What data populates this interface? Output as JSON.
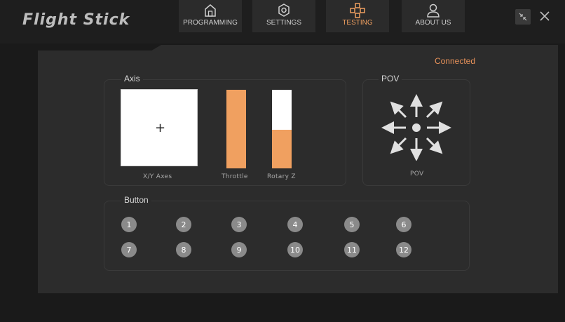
{
  "app": {
    "title": "Flight Stick"
  },
  "tabs": [
    {
      "label": "PROGRAMMING",
      "icon": "home-icon"
    },
    {
      "label": "SETTINGS",
      "icon": "gear-icon"
    },
    {
      "label": "TESTING",
      "icon": "gamepad-icon",
      "active": true
    },
    {
      "label": "ABOUT US",
      "icon": "user-icon"
    }
  ],
  "status": {
    "text": "Connected",
    "color": "#e8925a"
  },
  "axis": {
    "title": "Axis",
    "xy_label": "X/Y Axes",
    "throttle_label": "Throttle",
    "throttle_level": 1.0,
    "rotary_label": "Rotary Z",
    "rotary_level": 0.49
  },
  "pov": {
    "title": "POV",
    "label": "POV"
  },
  "buttons": {
    "title": "Button",
    "items": [
      "1",
      "2",
      "3",
      "4",
      "5",
      "6",
      "7",
      "8",
      "9",
      "10",
      "11",
      "12"
    ]
  },
  "colors": {
    "accent": "#f0a060",
    "panel": "#2c2c2c",
    "background": "#1a1a1a"
  }
}
